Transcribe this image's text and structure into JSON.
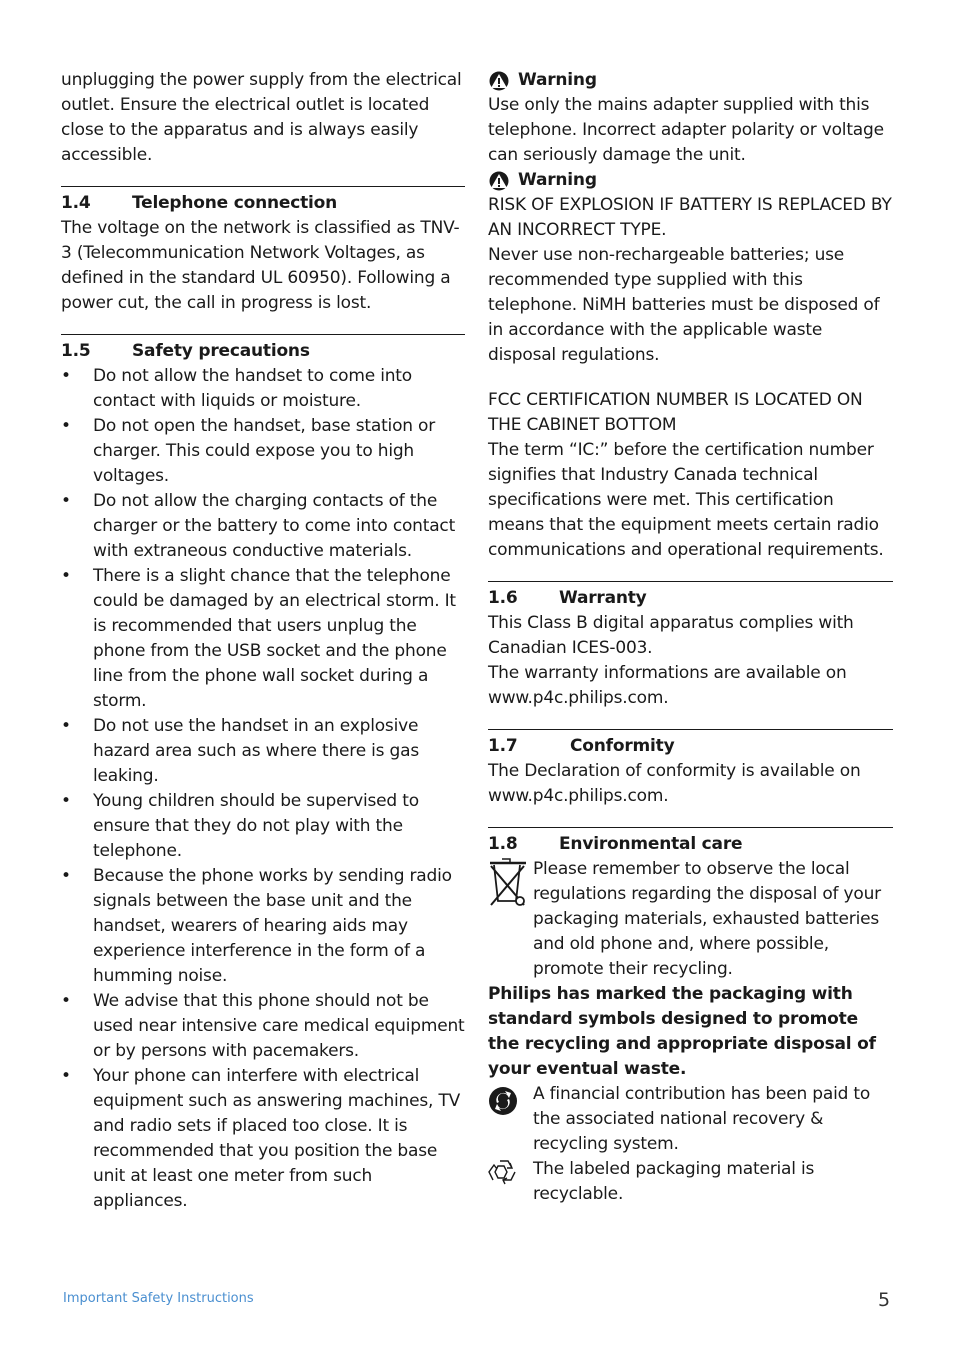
{
  "left": {
    "intro": "unplugging the power supply from the electrical outlet. Ensure the electrical outlet is located close to the apparatus and is always easily accessible.",
    "s14": {
      "num": "1.4",
      "title": "Telephone connection",
      "body": "The voltage on the network is classified as TNV-3 (Telecommunication Network Voltages, as defined in the standard UL 60950). Following a power cut, the call in progress is lost."
    },
    "s15": {
      "num": "1.5",
      "title": "Safety precautions",
      "bullets": [
        "Do not allow the handset to come into contact with liquids or moisture.",
        "Do not open the handset, base station or charger. This could expose you to high voltages.",
        "Do not allow the charging contacts of the charger or the battery to come into contact with extraneous conductive materials.",
        "There is a slight chance that the telephone could be damaged by an electrical storm. It is recommended that users unplug the phone from the USB socket and the phone line from the phone wall socket during a storm.",
        "Do not use the handset in an explosive hazard area such as where there is gas leaking.",
        "Young children should be supervised to ensure that they do not play with the telephone.",
        "Because the phone works by sending radio signals between the base unit and the handset, wearers of hearing aids may experience interference in the form of a humming noise.",
        "We advise that this phone should not be used near intensive care medical equipment or by persons with pacemakers.",
        "Your phone can interfere with electrical equipment such as answering machines, TV and radio sets if placed too close. It is recommended that you position the base unit at least one meter from such appliances."
      ]
    }
  },
  "right": {
    "warning1": {
      "label": "Warning",
      "body": "Use only the mains adapter supplied with this telephone. Incorrect adapter polarity or voltage can seriously damage the unit."
    },
    "warning2": {
      "label": "Warning",
      "caps": "RISK OF EXPLOSION IF BATTERY IS REPLACED BY AN INCORRECT TYPE.",
      "body": "Never use non-rechargeable batteries; use recommended type supplied with this telephone. NiMH batteries must be disposed of in accordance with the applicable waste disposal regulations."
    },
    "fcc": {
      "caps": "FCC CERTIFICATION NUMBER IS LOCATED ON THE CABINET BOTTOM",
      "body": "The term “IC:” before the certification number signifies that Industry Canada technical specifications were met. This certification means that the equipment meets certain radio communications and operational requirements."
    },
    "s16": {
      "num": "1.6",
      "title": "Warranty",
      "line1": "This Class B digital apparatus complies with Canadian ICES-003.",
      "line2": "The warranty informations are available on www.p4c.philips.com."
    },
    "s17": {
      "num": "1.7",
      "title": "Conformity",
      "body": "The Declaration of conformity is available on www.p4c.philips.com."
    },
    "s18": {
      "num": "1.8",
      "title": "Environmental care",
      "bin_text": "Please remember to observe the local regulations regarding the disposal of your packaging materials, exhausted batteries and old phone and, where possible, promote their recycling.",
      "bold": "Philips has marked the packaging with standard symbols designed to promote the recycling and appropriate disposal of your eventual waste.",
      "dot_text": "A financial contribution has been paid to the associated national recovery & recycling system.",
      "recycle_text": "The labeled packaging material is recyclable."
    }
  },
  "footer": {
    "section": "Important Safety Instructions",
    "page": "5"
  }
}
